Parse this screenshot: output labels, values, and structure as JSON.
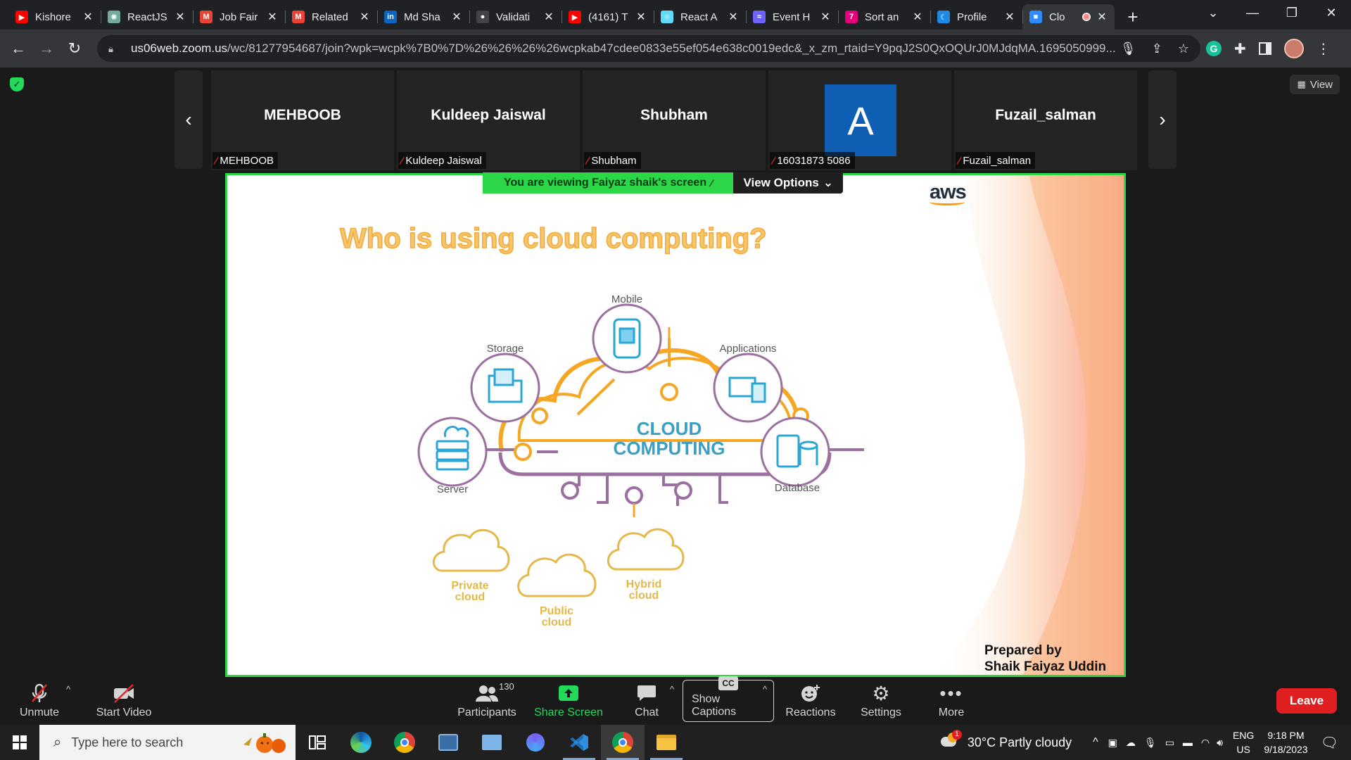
{
  "browser": {
    "tabs": [
      {
        "label": "Kishore",
        "icon": "youtube-icon",
        "color": "#ff0000",
        "glyph": "▶"
      },
      {
        "label": "ReactJS",
        "icon": "chatgpt-icon",
        "color": "#74aa9c",
        "glyph": "✺"
      },
      {
        "label": "Job Fair",
        "icon": "gmail-icon",
        "color": "#ea4335",
        "glyph": "M"
      },
      {
        "label": "Related",
        "icon": "gmail-icon",
        "color": "#ea4335",
        "glyph": "M"
      },
      {
        "label": "Md Sha",
        "icon": "linkedin-icon",
        "color": "#0a66c2",
        "glyph": "in"
      },
      {
        "label": "Validati",
        "icon": "github-icon",
        "color": "#444444",
        "glyph": "●"
      },
      {
        "label": "(4161) T",
        "icon": "youtube-icon",
        "color": "#ff0000",
        "glyph": "▶"
      },
      {
        "label": "React A",
        "icon": "react-icon",
        "color": "#61dafb",
        "glyph": "⚛"
      },
      {
        "label": "Event H",
        "icon": "event-icon",
        "color": "#6c63ff",
        "glyph": "≈"
      },
      {
        "label": "Sort an",
        "icon": "sort-icon",
        "color": "#e6007e",
        "glyph": "7"
      },
      {
        "label": "Profile",
        "icon": "moon-icon",
        "color": "#1e88e5",
        "glyph": "☾"
      },
      {
        "label": "Clo",
        "icon": "zoom-icon",
        "color": "#2d8cff",
        "glyph": "■",
        "active": true
      }
    ],
    "url_host": "us06web.zoom.us",
    "url_path": "/wc/81277954687/join?wpk=wcpk%7B0%7D%26%26%26%26wcpkab47cdee0833e55ef054e638c0019edc&_x_zm_rtaid=Y9pqJ2S0QxOQUrJ0MJdqMA.1695050999..."
  },
  "meeting": {
    "view_label": "View",
    "participants_tiles": [
      {
        "display": "MEHBOOB",
        "nameplate": "MEHBOOB"
      },
      {
        "display": "Kuldeep Jaiswal",
        "nameplate": "Kuldeep Jaiswal"
      },
      {
        "display": "Shubham",
        "nameplate": "Shubham"
      },
      {
        "display": "A",
        "nameplate": "16031873 5086",
        "avatar": true
      },
      {
        "display": "Fuzail_salman",
        "nameplate": "Fuzail_salman"
      }
    ],
    "viewing_text": "You are viewing  Faiyaz shaik's screen",
    "view_options": "View Options"
  },
  "slide": {
    "title": "Who is using cloud computing?",
    "logo": "aws",
    "center_line1": "CLOUD",
    "center_line2": "COMPUTING",
    "nodes": {
      "mobile": "Mobile",
      "storage": "Storage",
      "applications": "Applications",
      "server": "Server",
      "database": "Database"
    },
    "clouds": {
      "private_1": "Private",
      "private_2": "cloud",
      "public_1": "Public",
      "public_2": "cloud",
      "hybrid_1": "Hybrid",
      "hybrid_2": "cloud"
    },
    "footer_line1": "Prepared by",
    "footer_line2": "Shaik Faiyaz Uddin",
    "accent_orange": "#f5a623",
    "accent_purple": "#9b6f9f"
  },
  "toolbar": {
    "unmute": "Unmute",
    "start_video": "Start Video",
    "participants": "Participants",
    "participants_count": "130",
    "share_screen": "Share Screen",
    "chat": "Chat",
    "show_captions": "Show Captions",
    "cc": "CC",
    "reactions": "Reactions",
    "settings": "Settings",
    "more": "More",
    "leave": "Leave"
  },
  "taskbar": {
    "search_placeholder": "Type here to search",
    "weather": "30°C  Partly cloudy",
    "weather_badge": "1",
    "lang_line1": "ENG",
    "lang_line2": "US",
    "time": "9:18 PM",
    "date": "9/18/2023"
  }
}
